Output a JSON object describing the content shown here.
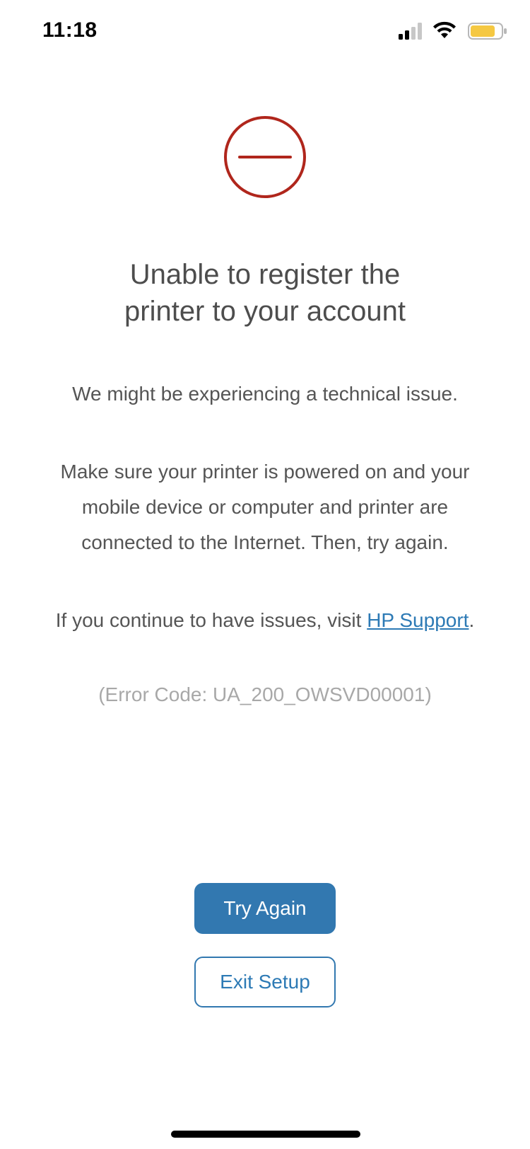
{
  "status_bar": {
    "time": "11:18",
    "signal_icon": "cellular-signal-icon",
    "wifi_icon": "wifi-icon",
    "battery_icon": "battery-icon",
    "battery_color": "#f5c842"
  },
  "error": {
    "icon": "error-minus-circle-icon",
    "icon_color": "#b0261c"
  },
  "title": {
    "line1": "Unable to register the",
    "line2": "printer to your account"
  },
  "body": {
    "p1": "We might be experiencing a technical issue.",
    "p2_line1": "Make sure your printer is powered on and your",
    "p2_line2": "mobile device or computer and printer are",
    "p2_line3": "connected to the Internet. Then, try again.",
    "p3_prefix": "If you continue to have issues, visit ",
    "p3_link": "HP Support",
    "p3_suffix": "."
  },
  "error_code": "(Error Code: UA_200_OWSVD00001)",
  "buttons": {
    "primary": "Try Again",
    "secondary": "Exit Setup"
  },
  "colors": {
    "accent": "#3278b0",
    "link": "#2d7ab5",
    "title_text": "#4d4d4d",
    "muted_text": "#a8a8a8"
  }
}
